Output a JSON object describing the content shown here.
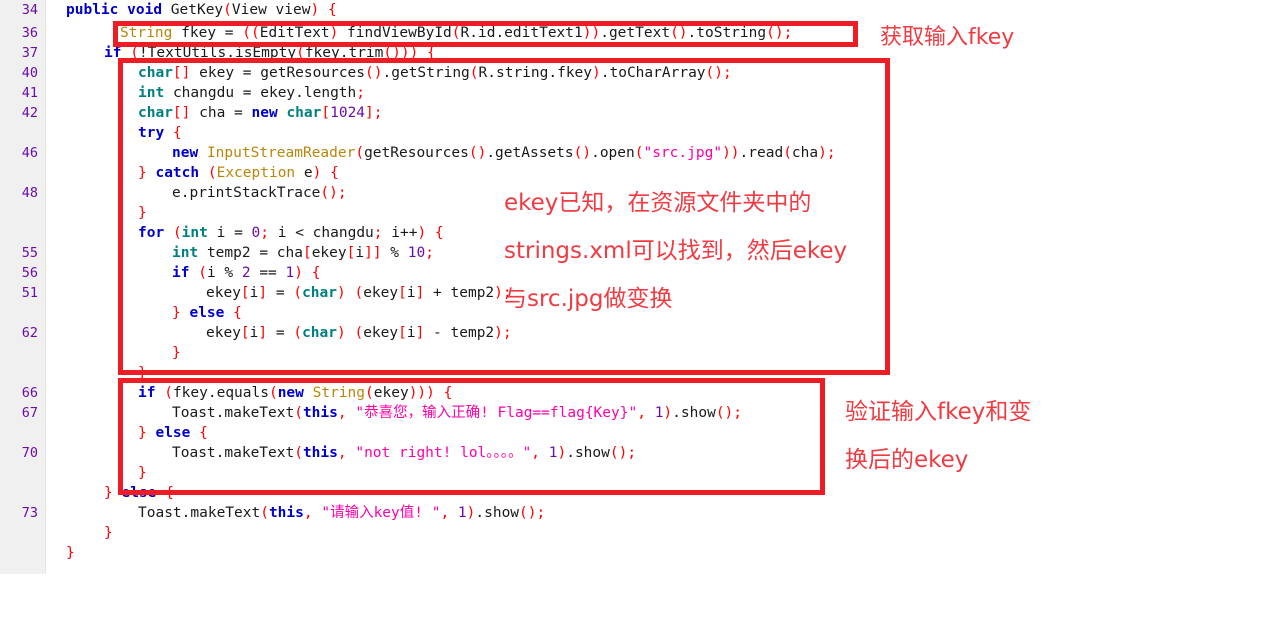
{
  "editor": {
    "language": "java",
    "gutter_bg": "#f0f0f0",
    "page_bg": "#ffffff",
    "annotation_color": "#ee1c25",
    "linenumber_color": "#6a0dad"
  },
  "code_lines": [
    {
      "no": "34",
      "indent": 0,
      "text": "public void GetKey(View view) {"
    },
    {
      "no": "36",
      "indent": 0,
      "text": "String fkey = ((EditText) findViewById(R.id.editText1)).getText().toString();"
    },
    {
      "no": "37",
      "indent": 0,
      "text": "if (!TextUtils.isEmpty(fkey.trim())) {"
    },
    {
      "no": "40",
      "indent": 0,
      "text": "char[] ekey = getResources().getString(R.string.fkey).toCharArray();"
    },
    {
      "no": "41",
      "indent": 0,
      "text": "int changdu = ekey.length;"
    },
    {
      "no": "42",
      "indent": 0,
      "text": "char[] cha = new char[1024];"
    },
    {
      "no": "",
      "indent": 0,
      "text": "try {"
    },
    {
      "no": "46",
      "indent": 0,
      "text": "new InputStreamReader(getResources().getAssets().open(\"src.jpg\")).read(cha);"
    },
    {
      "no": "",
      "indent": 0,
      "text": "} catch (Exception e) {"
    },
    {
      "no": "48",
      "indent": 0,
      "text": "e.printStackTrace();"
    },
    {
      "no": "",
      "indent": 0,
      "text": "}"
    },
    {
      "no": "",
      "indent": 0,
      "text": "for (int i = 0; i < changdu; i++) {"
    },
    {
      "no": "55",
      "indent": 0,
      "text": "int temp2 = cha[ekey[i]] % 10;"
    },
    {
      "no": "56",
      "indent": 0,
      "text": "if (i % 2 == 1) {"
    },
    {
      "no": "51",
      "indent": 0,
      "text": "ekey[i] = (char) (ekey[i] + temp2);"
    },
    {
      "no": "",
      "indent": 0,
      "text": "} else {"
    },
    {
      "no": "62",
      "indent": 0,
      "text": "ekey[i] = (char) (ekey[i] - temp2);"
    },
    {
      "no": "",
      "indent": 0,
      "text": "}"
    },
    {
      "no": "",
      "indent": 0,
      "text": "}"
    },
    {
      "no": "66",
      "indent": 0,
      "text": "if (fkey.equals(new String(ekey))) {"
    },
    {
      "no": "67",
      "indent": 0,
      "text": "Toast.makeText(this, \"恭喜您，输入正确! Flag==flag{Key}\", 1).show();"
    },
    {
      "no": "",
      "indent": 0,
      "text": "} else {"
    },
    {
      "no": "70",
      "indent": 0,
      "text": "Toast.makeText(this, \"not right! lol。。。。\", 1).show();"
    },
    {
      "no": "",
      "indent": 0,
      "text": "}"
    },
    {
      "no": "",
      "indent": 0,
      "text": "} else {"
    },
    {
      "no": "73",
      "indent": 0,
      "text": "Toast.makeText(this, \"请输入key值! \", 1).show();"
    },
    {
      "no": "",
      "indent": 0,
      "text": "}"
    },
    {
      "no": "",
      "indent": 0,
      "text": "}"
    }
  ],
  "annotations": {
    "note1": "获取输入fkey",
    "note2_line1": "ekey已知，在资源文件夹中的",
    "note2_line2": "strings.xml可以找到，然后ekey",
    "note2_line3": "与src.jpg做变换",
    "note3_line1": "验证输入fkey和变",
    "note3_line2": "换后的ekey"
  },
  "highlight_boxes": [
    {
      "name": "fkey-input-box",
      "label": "获取输入fkey"
    },
    {
      "name": "ekey-transform-box",
      "label": "ekey已知，在资源文件夹中的 strings.xml可以找到，然后ekey 与src.jpg做变换"
    },
    {
      "name": "verify-box",
      "label": "验证输入fkey和变 换后的ekey"
    }
  ]
}
